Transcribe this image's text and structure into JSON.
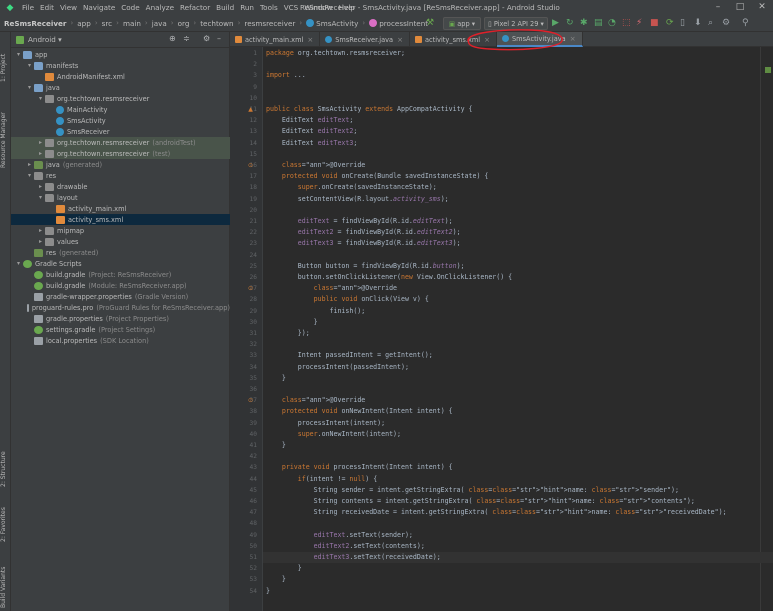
{
  "window": {
    "title": "ReSmsReceiver - SmsActivity.java [ReSmsReceiver.app] - Android Studio"
  },
  "menu": [
    "File",
    "Edit",
    "View",
    "Navigate",
    "Code",
    "Analyze",
    "Refactor",
    "Build",
    "Run",
    "Tools",
    "VCS",
    "Window",
    "Help"
  ],
  "breadcrumb": [
    "ReSmsReceiver",
    "app",
    "src",
    "main",
    "java",
    "org",
    "techtown",
    "resmsreceiver",
    "SmsActivity",
    "processIntent"
  ],
  "toolbar": {
    "run_config": "app",
    "device": "Pixel 2 API 29"
  },
  "panel": {
    "view_mode": "Android"
  },
  "side_tabs": {
    "project": "1: Project",
    "resource_manager": "Resource Manager",
    "structure": "2: Structure",
    "favorites": "2: Favorites",
    "build_variants": "Build Variants"
  },
  "tree": [
    {
      "label": "app",
      "extra": "",
      "icon": "folder-icon"
    },
    {
      "label": "manifests",
      "extra": "",
      "icon": "folder-icon"
    },
    {
      "label": "AndroidManifest.xml",
      "extra": "",
      "icon": "xml-file-icon"
    },
    {
      "label": "java",
      "extra": "",
      "icon": "folder-icon"
    },
    {
      "label": "org.techtown.resmsreceiver",
      "extra": "",
      "icon": "package-icon"
    },
    {
      "label": "MainActivity",
      "extra": "",
      "icon": "class-icon"
    },
    {
      "label": "SmsActivity",
      "extra": "",
      "icon": "class-icon"
    },
    {
      "label": "SmsReceiver",
      "extra": "",
      "icon": "class-icon"
    },
    {
      "label": "org.techtown.resmsreceiver",
      "extra": "(androidTest)",
      "icon": "package-icon"
    },
    {
      "label": "org.techtown.resmsreceiver",
      "extra": "(test)",
      "icon": "package-icon"
    },
    {
      "label": "java",
      "extra": "(generated)",
      "icon": "folder-icon"
    },
    {
      "label": "res",
      "extra": "",
      "icon": "folder-icon"
    },
    {
      "label": "drawable",
      "extra": "",
      "icon": "folder-icon"
    },
    {
      "label": "layout",
      "extra": "",
      "icon": "folder-icon"
    },
    {
      "label": "activity_main.xml",
      "extra": "",
      "icon": "xml-file-icon"
    },
    {
      "label": "activity_sms.xml",
      "extra": "",
      "icon": "xml-file-icon"
    },
    {
      "label": "mipmap",
      "extra": "",
      "icon": "folder-icon"
    },
    {
      "label": "values",
      "extra": "",
      "icon": "folder-icon"
    },
    {
      "label": "res",
      "extra": "(generated)",
      "icon": "folder-icon"
    },
    {
      "label": "Gradle Scripts",
      "extra": "",
      "icon": "gradle-icon"
    },
    {
      "label": "build.gradle",
      "extra": "(Project: ReSmsReceiver)",
      "icon": "gradle-icon"
    },
    {
      "label": "build.gradle",
      "extra": "(Module: ReSmsReceiver.app)",
      "icon": "gradle-icon"
    },
    {
      "label": "gradle-wrapper.properties",
      "extra": "(Gradle Version)",
      "icon": "properties-icon"
    },
    {
      "label": "proguard-rules.pro",
      "extra": "(ProGuard Rules for ReSmsReceiver.app)",
      "icon": "file-icon"
    },
    {
      "label": "gradle.properties",
      "extra": "(Project Properties)",
      "icon": "properties-icon"
    },
    {
      "label": "settings.gradle",
      "extra": "(Project Settings)",
      "icon": "gradle-icon"
    },
    {
      "label": "local.properties",
      "extra": "(SDK Location)",
      "icon": "properties-icon"
    }
  ],
  "tabs": [
    {
      "label": "activity_main.xml",
      "icon": "xml-file-icon"
    },
    {
      "label": "SmsReceiver.java",
      "icon": "java-class-icon"
    },
    {
      "label": "activity_sms.xml",
      "icon": "xml-file-icon"
    },
    {
      "label": "SmsActivity.java",
      "icon": "java-class-icon"
    }
  ],
  "editor": {
    "first_line": 1,
    "current_line": 51,
    "lines": [
      "package org.techtown.resmsreceiver;",
      "",
      "import ...",
      "",
      "",
      "public class SmsActivity extends AppCompatActivity {",
      "    EditText editText;",
      "    EditText editText2;",
      "    EditText editText3;",
      "",
      "    @Override",
      "    protected void onCreate(Bundle savedInstanceState) {",
      "        super.onCreate(savedInstanceState);",
      "        setContentView(R.layout.activity_sms);",
      "",
      "        editText = findViewById(R.id.editText);",
      "        editText2 = findViewById(R.id.editText2);",
      "        editText3 = findViewById(R.id.editText3);",
      "",
      "        Button button = findViewById(R.id.button);",
      "        button.setOnClickListener(new View.OnClickListener() {",
      "            @Override",
      "            public void onClick(View v) {",
      "                finish();",
      "            }",
      "        });",
      "",
      "        Intent passedIntent = getIntent();",
      "        processIntent(passedIntent);",
      "    }",
      "",
      "    @Override",
      "    protected void onNewIntent(Intent intent) {",
      "        processIntent(intent);",
      "        super.onNewIntent(intent);",
      "    }",
      "",
      "    private void processIntent(Intent intent) {",
      "        if(intent != null) {",
      "            String sender = intent.getStringExtra( name: \"sender\");",
      "            String contents = intent.getStringExtra( name: \"contents\");",
      "            String receivedDate = intent.getStringExtra( name: \"receivedDate\");",
      "",
      "            editText.setText(sender);",
      "            editText2.setText(contents);",
      "            editText3.setText(receivedDate);",
      "        }",
      "    }",
      "}"
    ],
    "line_numbers": [
      "1",
      "2",
      "3",
      "9",
      "10",
      "11",
      "12",
      "13",
      "14",
      "15",
      "16",
      "17",
      "18",
      "19",
      "20",
      "21",
      "22",
      "23",
      "24",
      "25",
      "26",
      "27",
      "28",
      "29",
      "30",
      "31",
      "32",
      "33",
      "34",
      "35",
      "36",
      "37",
      "38",
      "39",
      "40",
      "41",
      "42",
      "43",
      "44",
      "45",
      "46",
      "47",
      "48",
      "49",
      "50",
      "51",
      "52",
      "53",
      "54"
    ]
  },
  "colors": {
    "keyword": "#cc7832",
    "string": "#6a8759",
    "field": "#9876aa",
    "annotation": "#bbb529",
    "method": "#ffc66d",
    "text": "#a9b7c6",
    "annotation_circle": "#e0202a"
  }
}
